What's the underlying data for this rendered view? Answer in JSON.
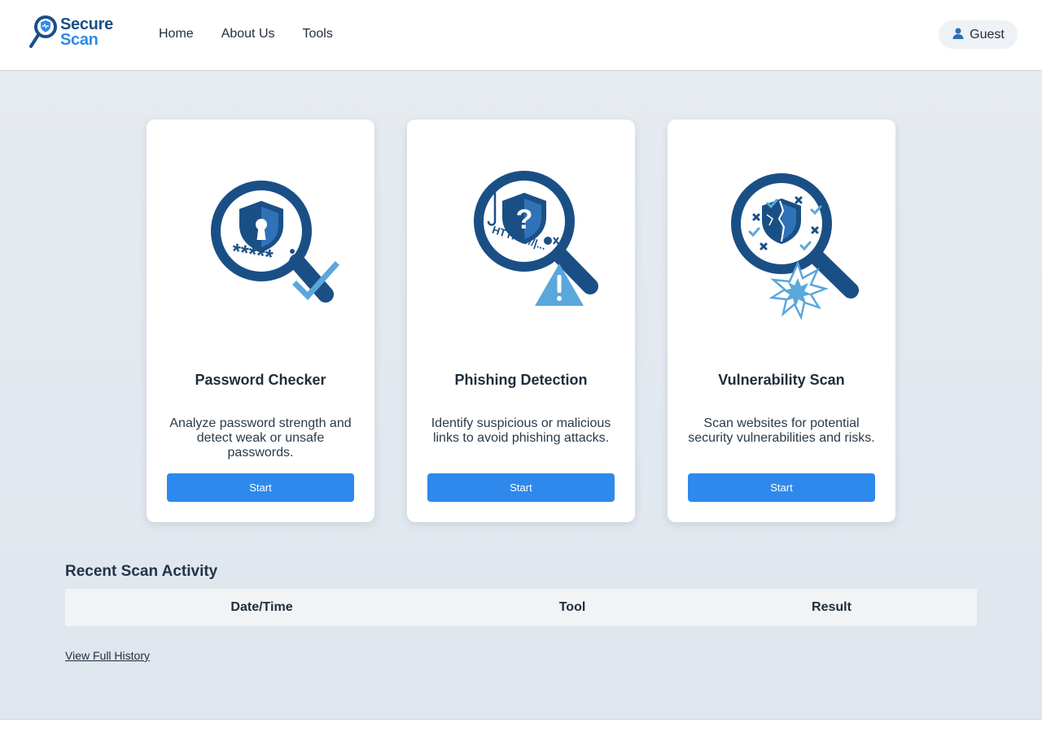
{
  "header": {
    "logo": {
      "line1": "Secure",
      "line2": "Scan",
      "icon": "magnifier-shield-icon"
    },
    "nav": [
      {
        "label": "Home"
      },
      {
        "label": "About Us"
      },
      {
        "label": "Tools",
        "caret": ""
      }
    ],
    "user": {
      "label": "Guest",
      "icon": "user-icon"
    }
  },
  "cards": [
    {
      "title": "Password Checker",
      "description": "Analyze password strength and detect weak or unsafe passwords.",
      "button": "Start",
      "icon": "password-magnifier-icon",
      "illustration_text": "*****"
    },
    {
      "title": "Phishing Detection",
      "description": "Identify suspicious or malicious links to avoid phishing attacks.",
      "button": "Start",
      "icon": "phishing-magnifier-icon",
      "illustration_text": "HTTPS://|..."
    },
    {
      "title": "Vulnerability Scan",
      "description": "Scan websites for potential security vulnerabilities and risks.",
      "button": "Start",
      "icon": "vulnerability-magnifier-icon"
    }
  ],
  "recent": {
    "title": "Recent Scan Activity",
    "columns": [
      "Date/Time",
      "Tool",
      "Result"
    ],
    "rows": [],
    "history_link": "View Full History"
  },
  "colors": {
    "brand_dark": "#1a4f86",
    "brand_light": "#2f8ae8",
    "button": "#2e89ec",
    "illustration_dark": "#1a4f86",
    "illustration_light": "#5aa7dc"
  }
}
